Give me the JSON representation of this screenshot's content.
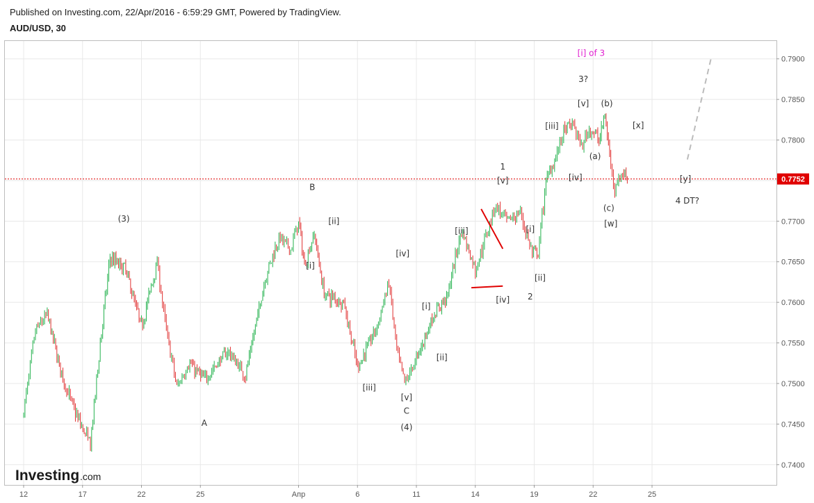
{
  "header": {
    "published": "Published on Investing.com, 22/Apr/2016 - 6:59:29 GMT, Powered by TradingView.",
    "symbol": "AUD/USD, 30"
  },
  "logo": {
    "main": "Investing",
    "suffix": ".com"
  },
  "colors": {
    "up": "#22b14c",
    "down": "#e03030",
    "grid": "#e8e8e8",
    "price_line": "#e00000",
    "annotation_pink": "#e020d0",
    "projection": "#bbbbbb"
  },
  "current_price": {
    "value": 0.7752,
    "label": "0.7752"
  },
  "chart_data": {
    "type": "candlestick",
    "title": "",
    "ylim": [
      0.7375,
      0.7922
    ],
    "y_ticks": [
      "0.7900",
      "0.7850",
      "0.7800",
      "0.7750",
      "0.7700",
      "0.7650",
      "0.7600",
      "0.7550",
      "0.7500",
      "0.7450",
      "0.7400"
    ],
    "x_ticks": [
      "12",
      "17",
      "22",
      "25",
      "Апр",
      "6",
      "11",
      "14",
      "19",
      "22",
      "25"
    ],
    "x_index_range": [
      0,
      40
    ],
    "x_tick_index": [
      0,
      3,
      6,
      9,
      14,
      17,
      20,
      23,
      26,
      29,
      32
    ],
    "price_path": [
      [
        0,
        0.7465
      ],
      [
        0.6,
        0.7565
      ],
      [
        1.2,
        0.7585
      ],
      [
        2,
        0.7505
      ],
      [
        2.7,
        0.746
      ],
      [
        3.4,
        0.7425
      ],
      [
        3.9,
        0.755
      ],
      [
        4.4,
        0.7655
      ],
      [
        5.2,
        0.764
      ],
      [
        6,
        0.757
      ],
      [
        6.8,
        0.765
      ],
      [
        7.2,
        0.7575
      ],
      [
        7.8,
        0.7495
      ],
      [
        8.4,
        0.7525
      ],
      [
        9.2,
        0.7505
      ],
      [
        10.4,
        0.754
      ],
      [
        11.3,
        0.751
      ],
      [
        12.3,
        0.763
      ],
      [
        13,
        0.768
      ],
      [
        13.6,
        0.7665
      ],
      [
        14,
        0.77
      ],
      [
        14.3,
        0.7645
      ],
      [
        14.8,
        0.7685
      ],
      [
        15.3,
        0.761
      ],
      [
        16.3,
        0.76
      ],
      [
        17,
        0.752
      ],
      [
        18,
        0.757
      ],
      [
        18.6,
        0.7625
      ],
      [
        19,
        0.754
      ],
      [
        19.4,
        0.75
      ],
      [
        20,
        0.753
      ],
      [
        20.8,
        0.758
      ],
      [
        21.6,
        0.761
      ],
      [
        22.3,
        0.769
      ],
      [
        23,
        0.764
      ],
      [
        23.4,
        0.767
      ],
      [
        24,
        0.772
      ],
      [
        24.6,
        0.77
      ],
      [
        25.3,
        0.771
      ],
      [
        25.9,
        0.766
      ],
      [
        26.2,
        0.766
      ],
      [
        26.6,
        0.775
      ],
      [
        27.1,
        0.778
      ],
      [
        27.5,
        0.781
      ],
      [
        28,
        0.782
      ],
      [
        28.4,
        0.779
      ],
      [
        28.8,
        0.7815
      ],
      [
        29.3,
        0.78
      ],
      [
        29.6,
        0.783
      ],
      [
        29.9,
        0.777
      ],
      [
        30.1,
        0.7742
      ],
      [
        30.5,
        0.776
      ],
      [
        30.8,
        0.775
      ]
    ],
    "trendlines": [
      {
        "from": [
          22.8,
          0.7618
        ],
        "to": [
          24.4,
          0.762
        ],
        "color": "#e00000"
      },
      {
        "from": [
          23.3,
          0.7715
        ],
        "to": [
          24.4,
          0.7666
        ],
        "color": "#e00000"
      },
      {
        "from": [
          33.8,
          0.7776
        ],
        "to": [
          35.0,
          0.79
        ],
        "color": "#bbbbbb",
        "dashed": true
      }
    ]
  },
  "wave_labels": [
    {
      "text": "(3)",
      "x": 5.1,
      "y": 0.7703
    },
    {
      "text": "A",
      "x": 9.2,
      "y": 0.7451
    },
    {
      "text": "B",
      "x": 14.7,
      "y": 0.7742
    },
    {
      "text": "[i]",
      "x": 14.6,
      "y": 0.7645
    },
    {
      "text": "[ii]",
      "x": 15.8,
      "y": 0.77
    },
    {
      "text": "[iii]",
      "x": 17.6,
      "y": 0.7495
    },
    {
      "text": "[iv]",
      "x": 19.3,
      "y": 0.766
    },
    {
      "text": "[v]",
      "x": 19.5,
      "y": 0.7483
    },
    {
      "text": "C",
      "x": 19.5,
      "y": 0.7466
    },
    {
      "text": "(4)",
      "x": 19.5,
      "y": 0.7446
    },
    {
      "text": "[i]",
      "x": 20.5,
      "y": 0.7595
    },
    {
      "text": "[ii]",
      "x": 21.3,
      "y": 0.7532
    },
    {
      "text": "[iii]",
      "x": 22.3,
      "y": 0.7688
    },
    {
      "text": "[iv]",
      "x": 24.4,
      "y": 0.7603
    },
    {
      "text": "1",
      "x": 24.4,
      "y": 0.7767
    },
    {
      "text": "[v]",
      "x": 24.4,
      "y": 0.775
    },
    {
      "text": "[i]",
      "x": 25.8,
      "y": 0.769
    },
    {
      "text": "[ii]",
      "x": 26.3,
      "y": 0.763
    },
    {
      "text": "2",
      "x": 25.8,
      "y": 0.7607
    },
    {
      "text": "[iii]",
      "x": 26.9,
      "y": 0.7817
    },
    {
      "text": "[iv]",
      "x": 28.1,
      "y": 0.7754
    },
    {
      "text": "3?",
      "x": 28.5,
      "y": 0.7875
    },
    {
      "text": "[v]",
      "x": 28.5,
      "y": 0.7845
    },
    {
      "text": "[i] of 3",
      "x": 28.9,
      "y": 0.7907,
      "pink": true
    },
    {
      "text": "(a)",
      "x": 29.1,
      "y": 0.778
    },
    {
      "text": "(b)",
      "x": 29.7,
      "y": 0.7845
    },
    {
      "text": "(c)",
      "x": 29.8,
      "y": 0.7716
    },
    {
      "text": "[w]",
      "x": 29.9,
      "y": 0.7697
    },
    {
      "text": "[x]",
      "x": 31.3,
      "y": 0.7818
    },
    {
      "text": "[y]",
      "x": 33.7,
      "y": 0.7752
    },
    {
      "text": "4 DT?",
      "x": 33.8,
      "y": 0.7725
    }
  ]
}
